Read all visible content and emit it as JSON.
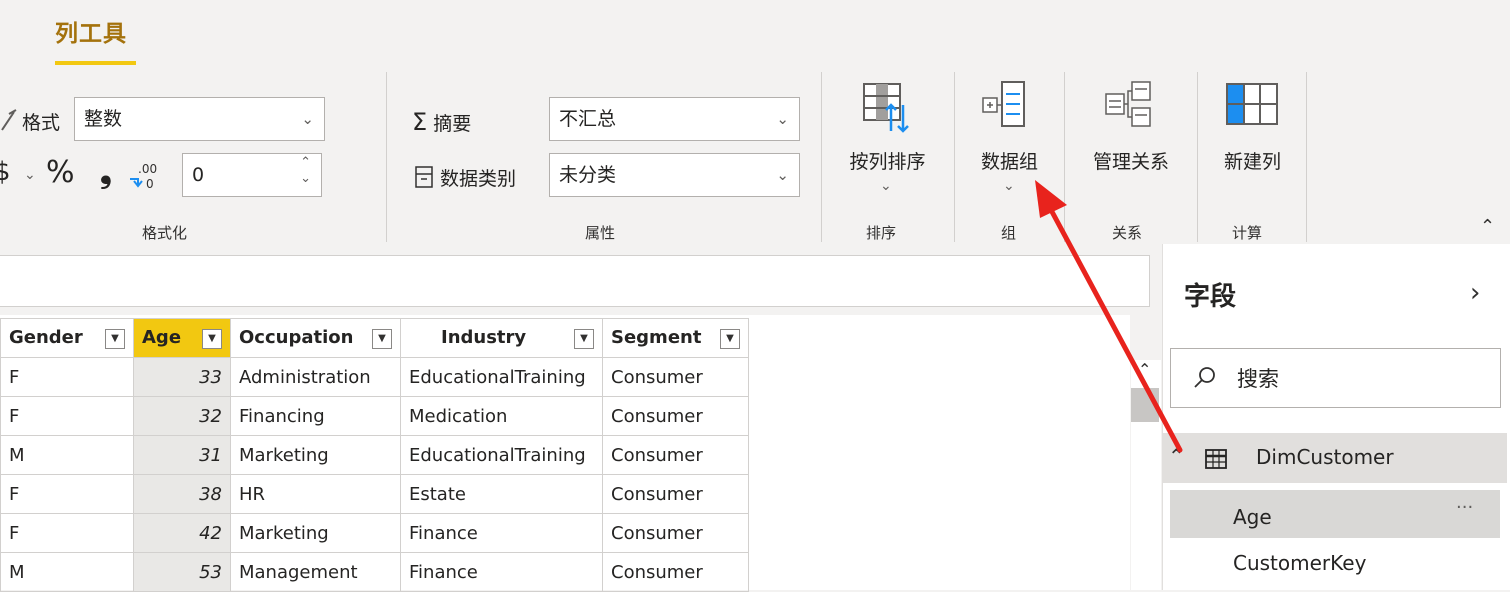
{
  "ribbon": {
    "tab_title": "列工具",
    "format_group": {
      "format_label": "格式",
      "format_value": "整数",
      "currency_symbol": "$",
      "percent_symbol": "%",
      "comma_symbol": "❟",
      "decimal_value": "0",
      "group_label": "格式化"
    },
    "properties_group": {
      "summarize_label": "摘要",
      "summarize_value": "不汇总",
      "category_label": "数据类别",
      "category_value": "未分类",
      "group_label": "属性"
    },
    "sort_group": {
      "button_label": "按列排序",
      "group_label": "排序"
    },
    "groups_group": {
      "button_label": "数据组",
      "group_label": "组"
    },
    "relationships_group": {
      "button_label": "管理关系",
      "group_label": "关系"
    },
    "calculations_group": {
      "button_label": "新建列",
      "group_label": "计算"
    }
  },
  "table": {
    "headers": [
      "Gender",
      "Age",
      "Occupation",
      "Industry",
      "Segment"
    ],
    "rows": [
      [
        "F",
        "33",
        "Administration",
        "EducationalTraining",
        "Consumer"
      ],
      [
        "F",
        "32",
        "Financing",
        "Medication",
        "Consumer"
      ],
      [
        "M",
        "31",
        "Marketing",
        "EducationalTraining",
        "Consumer"
      ],
      [
        "F",
        "38",
        "HR",
        "Estate",
        "Consumer"
      ],
      [
        "F",
        "42",
        "Marketing",
        "Finance",
        "Consumer"
      ],
      [
        "M",
        "53",
        "Management",
        "Finance",
        "Consumer"
      ]
    ]
  },
  "fields_pane": {
    "title": "字段",
    "search_placeholder": "搜索",
    "table_name": "DimCustomer",
    "fields": [
      "Age",
      "CustomerKey"
    ],
    "more_label": "···"
  },
  "colors": {
    "accent": "#f2c811",
    "tab_text": "#a4720c",
    "annotation_arrow": "#e8231d",
    "blue_icon": "#1c8ef0"
  }
}
